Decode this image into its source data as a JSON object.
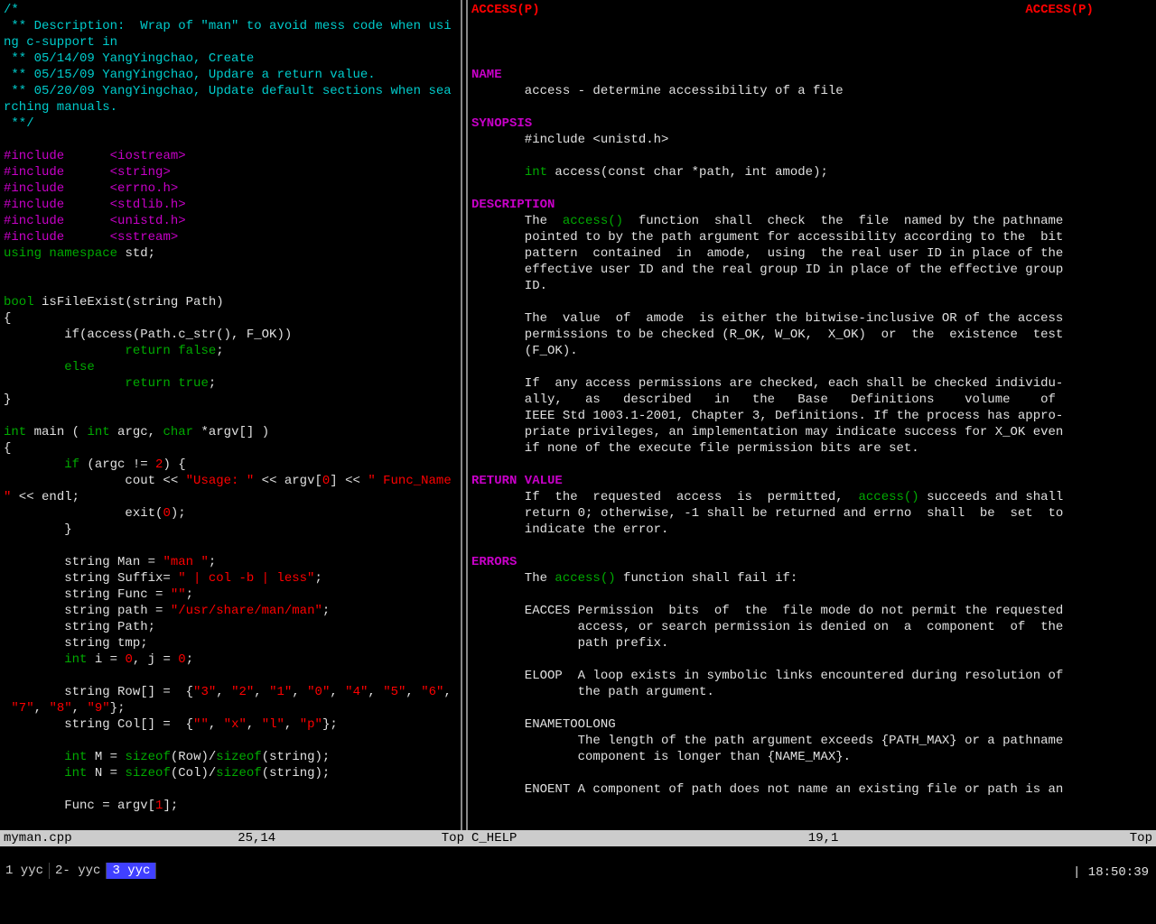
{
  "left": {
    "code_tokens": [
      [
        {
          "t": "/*",
          "c": "comment"
        }
      ],
      [
        {
          "t": " ** Description:  Wrap of \"man\" to avoid mess code when usi",
          "c": "comment"
        }
      ],
      [
        {
          "t": "ng c-support in",
          "c": "comment"
        }
      ],
      [
        {
          "t": " ** 05/14/09 YangYingchao, Create",
          "c": "comment"
        }
      ],
      [
        {
          "t": " ** 05/15/09 YangYingchao, Updare a return value.",
          "c": "comment"
        }
      ],
      [
        {
          "t": " ** 05/20/09 YangYingchao, Update default sections when sea",
          "c": "comment"
        }
      ],
      [
        {
          "t": "rching manuals.",
          "c": "comment"
        }
      ],
      [
        {
          "t": " **/",
          "c": "comment"
        }
      ],
      [
        {
          "t": "",
          "c": ""
        }
      ],
      [
        {
          "t": "#include",
          "c": "preproc"
        },
        {
          "t": "      ",
          "c": ""
        },
        {
          "t": "<iostream>",
          "c": "include-header"
        }
      ],
      [
        {
          "t": "#include",
          "c": "preproc"
        },
        {
          "t": "      ",
          "c": ""
        },
        {
          "t": "<string>",
          "c": "include-header"
        }
      ],
      [
        {
          "t": "#include",
          "c": "preproc"
        },
        {
          "t": "      ",
          "c": ""
        },
        {
          "t": "<errno.h>",
          "c": "include-header"
        }
      ],
      [
        {
          "t": "#include",
          "c": "preproc"
        },
        {
          "t": "      ",
          "c": ""
        },
        {
          "t": "<stdlib.h>",
          "c": "include-header"
        }
      ],
      [
        {
          "t": "#include",
          "c": "preproc"
        },
        {
          "t": "      ",
          "c": ""
        },
        {
          "t": "<unistd.h>",
          "c": "include-header"
        }
      ],
      [
        {
          "t": "#include",
          "c": "preproc"
        },
        {
          "t": "      ",
          "c": ""
        },
        {
          "t": "<sstream>",
          "c": "include-header"
        }
      ],
      [
        {
          "t": "using",
          "c": "keyword"
        },
        {
          "t": " ",
          "c": ""
        },
        {
          "t": "namespace",
          "c": "type"
        },
        {
          "t": " std;",
          "c": ""
        }
      ],
      [
        {
          "t": "",
          "c": ""
        }
      ],
      [
        {
          "t": "",
          "c": ""
        }
      ],
      [
        {
          "t": "bool",
          "c": "type"
        },
        {
          "t": " isFileExist(string Path)",
          "c": ""
        }
      ],
      [
        {
          "t": "{",
          "c": ""
        }
      ],
      [
        {
          "t": "        if(access(Path.c_str(), F_OK))",
          "c": ""
        }
      ],
      [
        {
          "t": "                ",
          "c": ""
        },
        {
          "t": "return",
          "c": "keyword"
        },
        {
          "t": " ",
          "c": ""
        },
        {
          "t": "false",
          "c": "keyword"
        },
        {
          "t": ";",
          "c": ""
        }
      ],
      [
        {
          "t": "        ",
          "c": ""
        },
        {
          "t": "else",
          "c": "keyword"
        }
      ],
      [
        {
          "t": "                ",
          "c": ""
        },
        {
          "t": "return",
          "c": "keyword"
        },
        {
          "t": " ",
          "c": ""
        },
        {
          "t": "true",
          "c": "keyword"
        },
        {
          "t": ";",
          "c": ""
        }
      ],
      [
        {
          "t": "}",
          "c": ""
        }
      ],
      [
        {
          "t": "",
          "c": ""
        }
      ],
      [
        {
          "t": "int",
          "c": "type"
        },
        {
          "t": " main ( ",
          "c": ""
        },
        {
          "t": "int",
          "c": "type"
        },
        {
          "t": " argc, ",
          "c": ""
        },
        {
          "t": "char",
          "c": "type"
        },
        {
          "t": " *argv[] )",
          "c": ""
        }
      ],
      [
        {
          "t": "{",
          "c": ""
        }
      ],
      [
        {
          "t": "        ",
          "c": ""
        },
        {
          "t": "if",
          "c": "keyword"
        },
        {
          "t": " (argc != ",
          "c": ""
        },
        {
          "t": "2",
          "c": "number"
        },
        {
          "t": ") {",
          "c": ""
        }
      ],
      [
        {
          "t": "                cout << ",
          "c": ""
        },
        {
          "t": "\"Usage: \"",
          "c": "string"
        },
        {
          "t": " << argv[",
          "c": ""
        },
        {
          "t": "0",
          "c": "number"
        },
        {
          "t": "] << ",
          "c": ""
        },
        {
          "t": "\" Func_Name",
          "c": "string"
        }
      ],
      [
        {
          "t": "\"",
          "c": "string"
        },
        {
          "t": " << endl;",
          "c": ""
        }
      ],
      [
        {
          "t": "                exit(",
          "c": ""
        },
        {
          "t": "0",
          "c": "number"
        },
        {
          "t": ");",
          "c": ""
        }
      ],
      [
        {
          "t": "        }",
          "c": ""
        }
      ],
      [
        {
          "t": "",
          "c": ""
        }
      ],
      [
        {
          "t": "        string Man = ",
          "c": ""
        },
        {
          "t": "\"man \"",
          "c": "string"
        },
        {
          "t": ";",
          "c": ""
        }
      ],
      [
        {
          "t": "        string Suffix= ",
          "c": ""
        },
        {
          "t": "\" | col -b | less\"",
          "c": "string"
        },
        {
          "t": ";",
          "c": ""
        }
      ],
      [
        {
          "t": "        string Func = ",
          "c": ""
        },
        {
          "t": "\"\"",
          "c": "string"
        },
        {
          "t": ";",
          "c": ""
        }
      ],
      [
        {
          "t": "        string path = ",
          "c": ""
        },
        {
          "t": "\"/usr/share/man/man\"",
          "c": "string"
        },
        {
          "t": ";",
          "c": ""
        }
      ],
      [
        {
          "t": "        string Path;",
          "c": ""
        }
      ],
      [
        {
          "t": "        string tmp;",
          "c": ""
        }
      ],
      [
        {
          "t": "        ",
          "c": ""
        },
        {
          "t": "int",
          "c": "type"
        },
        {
          "t": " i = ",
          "c": ""
        },
        {
          "t": "0",
          "c": "number"
        },
        {
          "t": ", j = ",
          "c": ""
        },
        {
          "t": "0",
          "c": "number"
        },
        {
          "t": ";",
          "c": ""
        }
      ],
      [
        {
          "t": "",
          "c": ""
        }
      ],
      [
        {
          "t": "        string Row[] =  {",
          "c": ""
        },
        {
          "t": "\"3\"",
          "c": "string"
        },
        {
          "t": ", ",
          "c": ""
        },
        {
          "t": "\"2\"",
          "c": "string"
        },
        {
          "t": ", ",
          "c": ""
        },
        {
          "t": "\"1\"",
          "c": "string"
        },
        {
          "t": ", ",
          "c": ""
        },
        {
          "t": "\"0\"",
          "c": "string"
        },
        {
          "t": ", ",
          "c": ""
        },
        {
          "t": "\"4\"",
          "c": "string"
        },
        {
          "t": ", ",
          "c": ""
        },
        {
          "t": "\"5\"",
          "c": "string"
        },
        {
          "t": ", ",
          "c": ""
        },
        {
          "t": "\"6\"",
          "c": "string"
        },
        {
          "t": ",",
          "c": ""
        }
      ],
      [
        {
          "t": " ",
          "c": ""
        },
        {
          "t": "\"7\"",
          "c": "string"
        },
        {
          "t": ", ",
          "c": ""
        },
        {
          "t": "\"8\"",
          "c": "string"
        },
        {
          "t": ", ",
          "c": ""
        },
        {
          "t": "\"9\"",
          "c": "string"
        },
        {
          "t": "};",
          "c": ""
        }
      ],
      [
        {
          "t": "        string Col[] =  {",
          "c": ""
        },
        {
          "t": "\"\"",
          "c": "string"
        },
        {
          "t": ", ",
          "c": ""
        },
        {
          "t": "\"x\"",
          "c": "string"
        },
        {
          "t": ", ",
          "c": ""
        },
        {
          "t": "\"l\"",
          "c": "string"
        },
        {
          "t": ", ",
          "c": ""
        },
        {
          "t": "\"p\"",
          "c": "string"
        },
        {
          "t": "};",
          "c": ""
        }
      ],
      [
        {
          "t": "",
          "c": ""
        }
      ],
      [
        {
          "t": "        ",
          "c": ""
        },
        {
          "t": "int",
          "c": "type"
        },
        {
          "t": " M = ",
          "c": ""
        },
        {
          "t": "sizeof",
          "c": "keyword"
        },
        {
          "t": "(Row)/",
          "c": ""
        },
        {
          "t": "sizeof",
          "c": "keyword"
        },
        {
          "t": "(string);",
          "c": ""
        }
      ],
      [
        {
          "t": "        ",
          "c": ""
        },
        {
          "t": "int",
          "c": "type"
        },
        {
          "t": " N = ",
          "c": ""
        },
        {
          "t": "sizeof",
          "c": "keyword"
        },
        {
          "t": "(Col)/",
          "c": ""
        },
        {
          "t": "sizeof",
          "c": "keyword"
        },
        {
          "t": "(string);",
          "c": ""
        }
      ],
      [
        {
          "t": "",
          "c": ""
        }
      ],
      [
        {
          "t": "        Func = argv[",
          "c": ""
        },
        {
          "t": "1",
          "c": "number"
        },
        {
          "t": "];",
          "c": ""
        }
      ]
    ]
  },
  "right": {
    "header_left": "ACCESS(P)",
    "header_right": "ACCESS(P)",
    "sections": [
      {
        "label": "NAME",
        "body": [
          "       access - determine accessibility of a file"
        ]
      },
      {
        "label": "SYNOPSIS",
        "body": [
          "       #include <unistd.h>",
          "",
          "       _FN_int access(const char *path, int amode);"
        ]
      },
      {
        "label": "DESCRIPTION",
        "body": [
          "       The  _FN_access()  function  shall  check  the  file  named by the pathname",
          "       pointed to by the path argument for accessibility according to the  bit",
          "       pattern  contained  in  amode,  using  the real user ID in place of the",
          "       effective user ID and the real group ID in place of the effective group",
          "       ID.",
          "",
          "       The  value  of  amode  is either the bitwise-inclusive OR of the access",
          "       permissions to be checked (R_OK, W_OK,  X_OK)  or  the  existence  test",
          "       (F_OK).",
          "",
          "       If  any access permissions are checked, each shall be checked individu-",
          "       ally,   as   described   in   the   Base   Definitions    volume    of",
          "       IEEE Std 1003.1-2001, Chapter 3, Definitions. If the process has appro-",
          "       priate privileges, an implementation may indicate success for X_OK even",
          "       if none of the execute file permission bits are set."
        ]
      },
      {
        "label": "RETURN VALUE",
        "body": [
          "       If  the  requested  access  is  permitted,  _FN_access() succeeds and shall",
          "       return 0; otherwise, -1 shall be returned and errno  shall  be  set  to",
          "       indicate the error."
        ]
      },
      {
        "label": "ERRORS",
        "body": [
          "       The _FN_access() function shall fail if:",
          "",
          "       EACCES Permission  bits  of  the  file mode do not permit the requested",
          "              access, or search permission is denied on  a  component  of  the",
          "              path prefix.",
          "",
          "       ELOOP  A loop exists in symbolic links encountered during resolution of",
          "              the path argument.",
          "",
          "       ENAMETOOLONG",
          "              The length of the path argument exceeds {PATH_MAX} or a pathname",
          "              component is longer than {NAME_MAX}.",
          "",
          "       ENOENT A component of path does not name an existing file or path is an"
        ]
      }
    ]
  },
  "status": {
    "left_file": "myman.cpp",
    "left_pos": "25,14",
    "left_scroll": "Top",
    "right_file": "C_HELP",
    "right_pos": "19,1",
    "right_scroll": "Top"
  },
  "tabs": [
    {
      "label": "1 yyc",
      "active": false
    },
    {
      "label": "2- yyc",
      "active": false
    },
    {
      "label": "3 yyc",
      "active": true
    }
  ],
  "clock": "| 18:50:39"
}
